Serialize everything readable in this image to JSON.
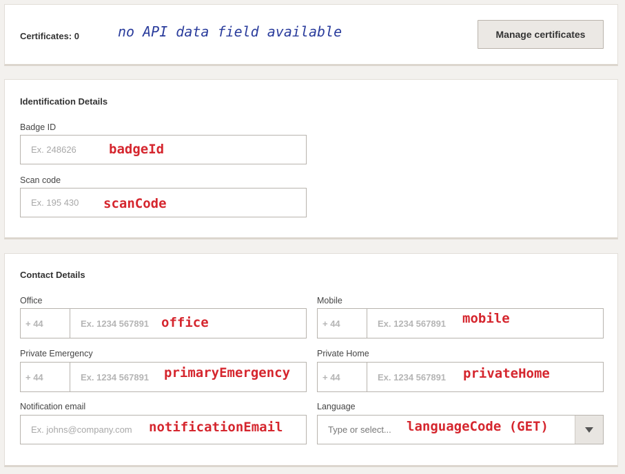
{
  "certificates": {
    "label": "Certificates: 0",
    "manage_button": "Manage certificates",
    "annotation": "no API data field available"
  },
  "identification": {
    "title": "Identification Details",
    "badge": {
      "label": "Badge ID",
      "placeholder": "Ex. 248626",
      "annotation": "badgeId"
    },
    "scan": {
      "label": "Scan code",
      "placeholder": "Ex. 195 430",
      "annotation": "scanCode"
    }
  },
  "contact": {
    "title": "Contact Details",
    "office": {
      "label": "Office",
      "prefix_placeholder": "+ 44",
      "placeholder": "Ex. 1234 567891",
      "annotation": "office"
    },
    "mobile": {
      "label": "Mobile",
      "prefix_placeholder": "+ 44",
      "placeholder": "Ex. 1234 567891",
      "annotation": "mobile"
    },
    "private_emergency": {
      "label": "Private Emergency",
      "prefix_placeholder": "+ 44",
      "placeholder": "Ex. 1234 567891",
      "annotation": "primaryEmergency"
    },
    "private_home": {
      "label": "Private Home",
      "prefix_placeholder": "+ 44",
      "placeholder": "Ex. 1234 567891",
      "annotation": "privateHome"
    },
    "notification_email": {
      "label": "Notification email",
      "placeholder": "Ex. johns@company.com",
      "annotation": "notificationEmail"
    },
    "language": {
      "label": "Language",
      "placeholder": "Type or select...",
      "annotation": "languageCode (GET)"
    }
  },
  "icons": {
    "language_dropdown": "chevron-down-icon"
  },
  "colors": {
    "annotation_red": "#d5262e",
    "annotation_blue": "#2a3c9c",
    "background": "#f3f1ee"
  }
}
